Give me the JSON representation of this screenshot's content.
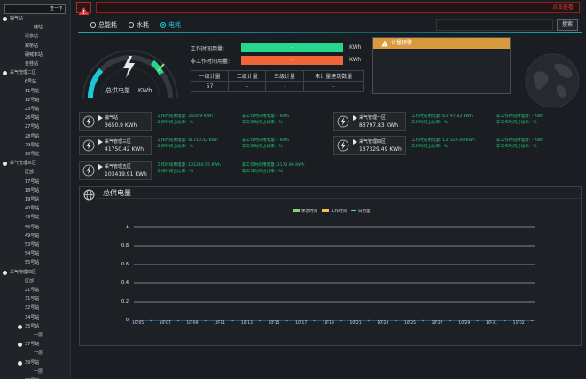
{
  "sidebar": {
    "search_button": "查一下",
    "items": [
      {
        "label": "输气站",
        "dot": true,
        "level": 0
      },
      {
        "label": "储站",
        "dot": false,
        "level": 2
      },
      {
        "label": "清泉站",
        "dot": false,
        "level": 1
      },
      {
        "label": "双桥站",
        "dot": false,
        "level": 1
      },
      {
        "label": "碾喊末站",
        "dot": false,
        "level": 1
      },
      {
        "label": "金桂站",
        "dot": false,
        "level": 1
      },
      {
        "label": "采气管理二区",
        "dot": true,
        "level": 0
      },
      {
        "label": "6号站",
        "dot": false,
        "level": 1
      },
      {
        "label": "11号站",
        "dot": false,
        "level": 1
      },
      {
        "label": "12号站",
        "dot": false,
        "level": 1
      },
      {
        "label": "23号站",
        "dot": false,
        "level": 1
      },
      {
        "label": "26号站",
        "dot": false,
        "level": 1
      },
      {
        "label": "27号站",
        "dot": false,
        "level": 1
      },
      {
        "label": "28号站",
        "dot": false,
        "level": 1
      },
      {
        "label": "29号站",
        "dot": false,
        "level": 1
      },
      {
        "label": "30号站",
        "dot": false,
        "level": 1
      },
      {
        "label": "采气管理三区",
        "dot": true,
        "level": 0
      },
      {
        "label": "区部",
        "dot": false,
        "level": 1
      },
      {
        "label": "17号站",
        "dot": false,
        "level": 1
      },
      {
        "label": "18号站",
        "dot": false,
        "level": 1
      },
      {
        "label": "19号站",
        "dot": false,
        "level": 1
      },
      {
        "label": "40号站",
        "dot": false,
        "level": 1
      },
      {
        "label": "43号站",
        "dot": false,
        "level": 1
      },
      {
        "label": "46号站",
        "dot": false,
        "level": 1
      },
      {
        "label": "49号站",
        "dot": false,
        "level": 1
      },
      {
        "label": "53号站",
        "dot": false,
        "level": 1
      },
      {
        "label": "54号站",
        "dot": false,
        "level": 1
      },
      {
        "label": "55号站",
        "dot": false,
        "level": 1
      },
      {
        "label": "采气管理四区",
        "dot": true,
        "level": 0
      },
      {
        "label": "区部",
        "dot": false,
        "level": 1
      },
      {
        "label": "21号站",
        "dot": false,
        "level": 1
      },
      {
        "label": "31号站",
        "dot": false,
        "level": 1
      },
      {
        "label": "32号站",
        "dot": false,
        "level": 1
      },
      {
        "label": "34号站",
        "dot": false,
        "level": 1
      },
      {
        "label": "35号站",
        "dot": true,
        "level": 1
      },
      {
        "label": "一层",
        "dot": false,
        "level": 2
      },
      {
        "label": "37号站",
        "dot": true,
        "level": 1
      },
      {
        "label": "一层",
        "dot": false,
        "level": 2
      },
      {
        "label": "39号站",
        "dot": true,
        "level": 1
      },
      {
        "label": "一层",
        "dot": false,
        "level": 2
      },
      {
        "label": "38号站",
        "dot": false,
        "level": 1
      }
    ]
  },
  "topbar": {
    "alarm_link": "点击查看"
  },
  "filters": {
    "options": [
      "总能耗",
      "水耗",
      "电耗"
    ],
    "selected": 2,
    "search_button": "搜索"
  },
  "gauge": {
    "label": "总供电量",
    "unit": "KWh"
  },
  "metrics": {
    "work_label": "工作时间用量:",
    "work_value": "-",
    "work_unit": "KWh",
    "nonwork_label": "非工作时间用量:",
    "nonwork_value": "-",
    "nonwork_unit": "KWh"
  },
  "meter_table": {
    "headers": [
      "一级计量",
      "二级计量",
      "三级计量",
      "未计量建筑数量"
    ],
    "values": [
      "57",
      "-",
      "-",
      "-"
    ]
  },
  "plan_box": {
    "title": "计量预警"
  },
  "cards": [
    {
      "name": "输气站",
      "value": "3650.9 KWh",
      "work_usage": "工作时间用电量: 3650.9 KWh",
      "work_pct": "工作时间占比率: -%",
      "nonwork_usage": "非工作时间用电量: - KWh",
      "nonwork_pct": "非工作时间占比率: -%"
    },
    {
      "name": "采气管理一区",
      "value": "83797.83 KWh",
      "work_usage": "工作时间用电量: 83797.83 KWh",
      "work_pct": "工作时间占比率: -%",
      "nonwork_usage": "非工作时间用电量: - KWh",
      "nonwork_pct": "非工作时间占比率: -%"
    },
    {
      "name": "采气管理三区",
      "value": "41750.42 KWh",
      "work_usage": "工作时间用电量: 41750.42 KWh",
      "work_pct": "工作时间占比率: -%",
      "nonwork_usage": "非工作时间用电量: - KWh",
      "nonwork_pct": "非工作时间占比率: -%"
    },
    {
      "name": "采气管理四区",
      "value": "137329.49 KWh",
      "work_usage": "工作时间用电量: 137329.49 KWh",
      "work_pct": "工作时间占比率: -%",
      "nonwork_usage": "非工作时间用电量: - KWh",
      "nonwork_pct": "非工作时间占比率: -%"
    },
    {
      "name": "采气管理五区",
      "value": "103419.91 KWh",
      "work_usage": "工作时间用电量: 101246.95 KWh",
      "work_pct": "工作时间占比率: -%",
      "nonwork_usage": "非工作时间用电量: 2172.96 KWh",
      "nonwork_pct": "非工作时间占比率: -%"
    }
  ],
  "chart_section": {
    "title": "总供电量"
  },
  "colors": {
    "accent_cyan": "#1cc8d8",
    "work_bar": "#25d68c",
    "nonwork_bar": "#f0653a",
    "plan_head": "#d89a3b",
    "alarm_red": "#e53c3c"
  },
  "chart_data": {
    "type": "line",
    "legend": [
      "休息时间",
      "工作时间",
      "日用量"
    ],
    "legend_colors": [
      "#8fd16a",
      "#f0c04a",
      "#5ad0f0"
    ],
    "x": [
      "10-05",
      "10-06",
      "10-07",
      "10-08",
      "10-09",
      "10-10",
      "10-11",
      "10-12",
      "10-13",
      "10-14",
      "10-15",
      "10-16",
      "10-17",
      "10-18",
      "10-19",
      "10-20",
      "10-21",
      "10-22",
      "10-23",
      "10-24",
      "10-25",
      "10-26",
      "10-27",
      "10-28",
      "10-29",
      "10-30",
      "10-31",
      "11-01",
      "11-02",
      "11-03"
    ],
    "x_tick_labels": [
      "10-05",
      "10-07",
      "10-09",
      "10-11",
      "10-13",
      "10-15",
      "10-17",
      "10-19",
      "10-21",
      "10-23",
      "10-25",
      "10-27",
      "10-29",
      "10-31",
      "11-02"
    ],
    "series": [
      {
        "name": "日用量",
        "values": [
          0,
          0,
          0,
          0,
          0,
          0,
          0,
          0,
          0,
          0,
          0,
          0,
          0,
          0,
          0,
          0,
          0,
          0,
          0,
          0,
          0,
          0,
          0,
          0,
          0,
          0,
          0,
          0,
          0,
          0
        ]
      }
    ],
    "yticks": [
      "0",
      "0.2",
      "0.4",
      "0.6",
      "0.8",
      "1"
    ],
    "ylim": [
      0,
      1
    ],
    "grid": true,
    "legend_position": "top-center"
  }
}
